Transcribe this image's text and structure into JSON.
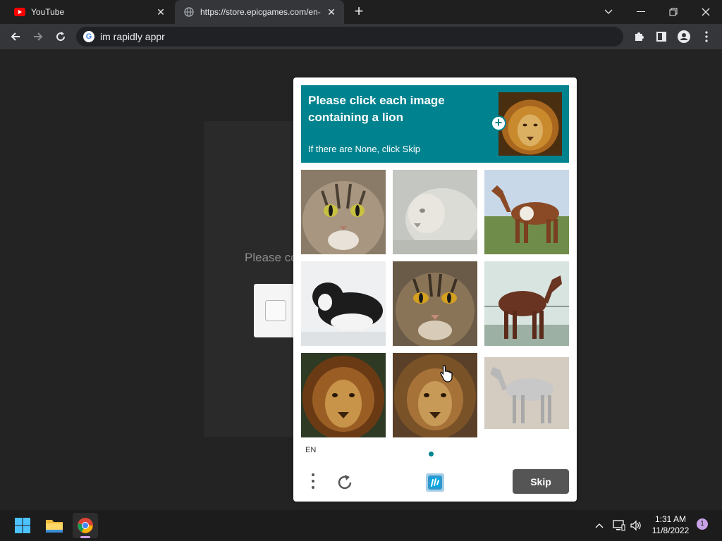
{
  "browser": {
    "tabs": [
      {
        "title": "YouTube",
        "icon": "youtube-icon"
      },
      {
        "title": "https://store.epicgames.com/en-",
        "icon": "globe-icon"
      }
    ],
    "new_tab_label": "+",
    "address": "im rapidly appr"
  },
  "background_page": {
    "prompt_text": "Please co"
  },
  "captcha": {
    "prompt_title": "Please click each image containing a lion",
    "prompt_subtitle": "If there are None, click Skip",
    "example": "lion",
    "tiles": [
      "cat",
      "lion",
      "horse",
      "dog",
      "cat",
      "horse",
      "lion",
      "lion",
      "horse"
    ],
    "language": "EN",
    "skip_label": "Skip",
    "accent_color": "#00838f"
  },
  "taskbar": {
    "time": "1:31 AM",
    "date": "11/8/2022",
    "notification_count": "1"
  }
}
